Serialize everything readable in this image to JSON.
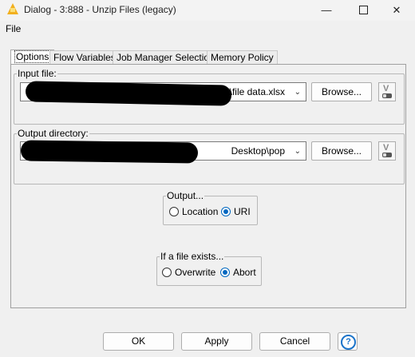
{
  "window": {
    "title": "Dialog - 3:888 - Unzip Files (legacy)",
    "minimize": "—",
    "close": "✕"
  },
  "menu": {
    "file": "File"
  },
  "tabs": [
    {
      "label": "Options",
      "active": true
    },
    {
      "label": "Flow Variables"
    },
    {
      "label": "Job Manager Selection"
    },
    {
      "label": "Memory Policy"
    }
  ],
  "input_file": {
    "legend": "Input file:",
    "value": "\\file data.xlsx",
    "browse": "Browse..."
  },
  "output_dir": {
    "legend": "Output directory:",
    "value": "Desktop\\pop",
    "browse": "Browse..."
  },
  "output_mode": {
    "legend": "Output...",
    "options": [
      "Location",
      "URI"
    ],
    "selected": "URI"
  },
  "if_exists": {
    "legend": "If a file exists...",
    "options": [
      "Overwrite",
      "Abort"
    ],
    "selected": "Abort"
  },
  "buttons": {
    "ok": "OK",
    "apply": "Apply",
    "cancel": "Cancel",
    "help": "?"
  },
  "colors": {
    "accent": "#0067c0"
  }
}
